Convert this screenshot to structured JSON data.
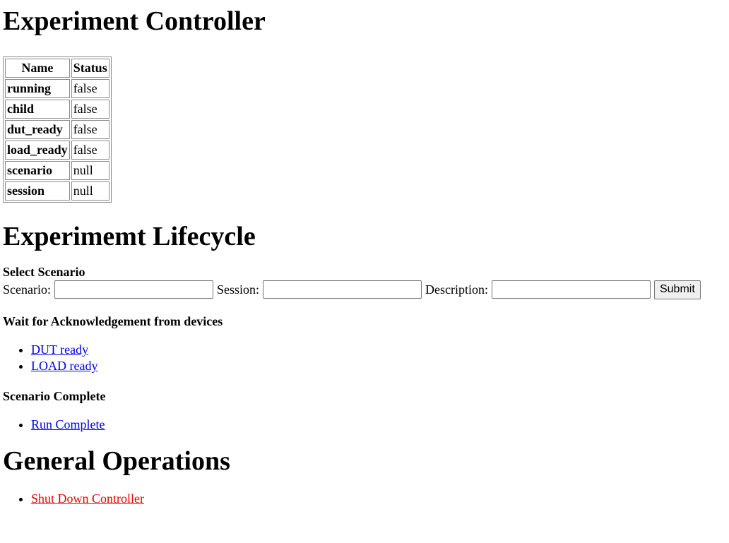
{
  "title": "Experiment Controller",
  "status_table": {
    "headers": [
      "Name",
      "Status"
    ],
    "rows": [
      {
        "name": "running",
        "status": "false"
      },
      {
        "name": "child",
        "status": "false"
      },
      {
        "name": "dut_ready",
        "status": "false"
      },
      {
        "name": "load_ready",
        "status": "false"
      },
      {
        "name": "scenario",
        "status": "null"
      },
      {
        "name": "session",
        "status": "null"
      }
    ]
  },
  "lifecycle": {
    "title": "Experimemt Lifecycle",
    "select_heading": "Select Scenario",
    "form": {
      "scenario_label": "Scenario:",
      "scenario_value": "",
      "session_label": "Session:",
      "session_value": "",
      "description_label": "Description:",
      "description_value": "",
      "submit_label": "Submit"
    },
    "wait_heading": "Wait for Acknowledgement from devices",
    "device_links": [
      "DUT ready",
      "LOAD ready"
    ],
    "complete_heading": "Scenario Complete",
    "complete_links": [
      "Run Complete"
    ]
  },
  "general": {
    "title": "General Operations",
    "links": [
      "Shut Down Controller"
    ]
  },
  "colors": {
    "link": "#0000ee",
    "danger_link": "#ee0000"
  }
}
